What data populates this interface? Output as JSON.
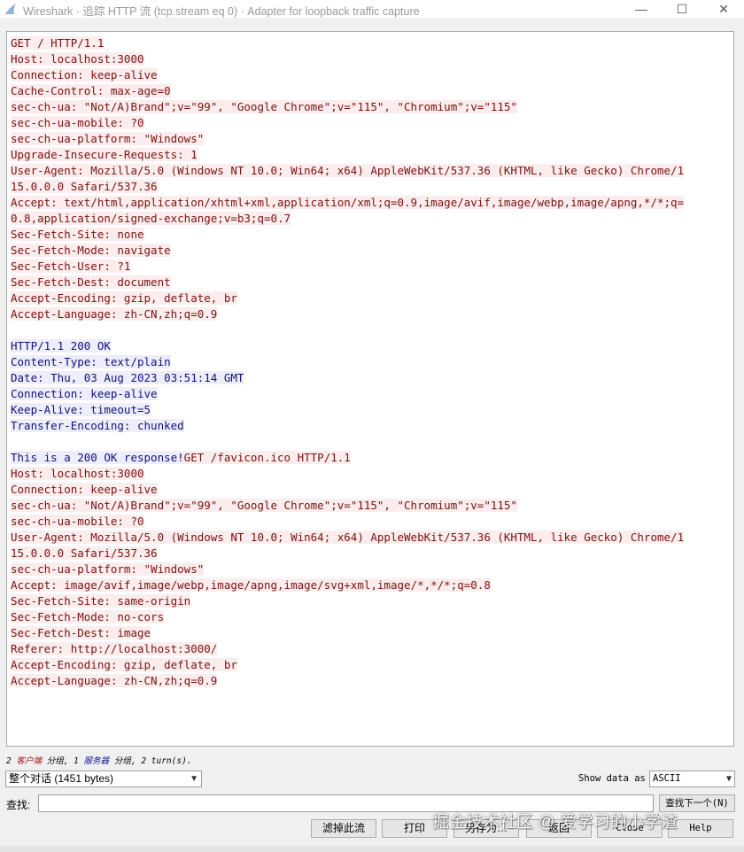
{
  "window": {
    "title": "Wireshark · 追踪 HTTP 流 (tcp.stream eq 0) · Adapter for loopback traffic capture",
    "icon": "wireshark-fin-icon",
    "controls": {
      "minimize": "—",
      "maximize": "☐",
      "close": "✕"
    }
  },
  "stream": {
    "lines": [
      [
        {
          "text": "GET / HTTP/1.1",
          "from": "client"
        }
      ],
      [
        {
          "text": "Host: localhost:3000",
          "from": "client"
        }
      ],
      [
        {
          "text": "Connection: keep-alive",
          "from": "client"
        }
      ],
      [
        {
          "text": "Cache-Control: max-age=0",
          "from": "client"
        }
      ],
      [
        {
          "text": "sec-ch-ua: \"Not/A)Brand\";v=\"99\", \"Google Chrome\";v=\"115\", \"Chromium\";v=\"115\"",
          "from": "client"
        }
      ],
      [
        {
          "text": "sec-ch-ua-mobile: ?0",
          "from": "client"
        }
      ],
      [
        {
          "text": "sec-ch-ua-platform: \"Windows\"",
          "from": "client"
        }
      ],
      [
        {
          "text": "Upgrade-Insecure-Requests: 1",
          "from": "client"
        }
      ],
      [
        {
          "text": "User-Agent: Mozilla/5.0 (Windows NT 10.0; Win64; x64) AppleWebKit/537.36 (KHTML, like Gecko) Chrome/1",
          "from": "client"
        }
      ],
      [
        {
          "text": "15.0.0.0 Safari/537.36",
          "from": "client"
        }
      ],
      [
        {
          "text": "Accept: text/html,application/xhtml+xml,application/xml;q=0.9,image/avif,image/webp,image/apng,*/*;q=",
          "from": "client"
        }
      ],
      [
        {
          "text": "0.8,application/signed-exchange;v=b3;q=0.7",
          "from": "client"
        }
      ],
      [
        {
          "text": "Sec-Fetch-Site: none",
          "from": "client"
        }
      ],
      [
        {
          "text": "Sec-Fetch-Mode: navigate",
          "from": "client"
        }
      ],
      [
        {
          "text": "Sec-Fetch-User: ?1",
          "from": "client"
        }
      ],
      [
        {
          "text": "Sec-Fetch-Dest: document",
          "from": "client"
        }
      ],
      [
        {
          "text": "Accept-Encoding: gzip, deflate, br",
          "from": "client"
        }
      ],
      [
        {
          "text": "Accept-Language: zh-CN,zh;q=0.9",
          "from": "client"
        }
      ],
      [],
      [
        {
          "text": "HTTP/1.1 200 OK",
          "from": "server"
        }
      ],
      [
        {
          "text": "Content-Type: text/plain",
          "from": "server"
        }
      ],
      [
        {
          "text": "Date: Thu, 03 Aug 2023 03:51:14 GMT",
          "from": "server"
        }
      ],
      [
        {
          "text": "Connection: keep-alive",
          "from": "server"
        }
      ],
      [
        {
          "text": "Keep-Alive: timeout=5",
          "from": "server"
        }
      ],
      [
        {
          "text": "Transfer-Encoding: chunked",
          "from": "server"
        }
      ],
      [],
      [
        {
          "text": "This is a 200 OK response!",
          "from": "server"
        },
        {
          "text": "GET /favicon.ico HTTP/1.1",
          "from": "client"
        }
      ],
      [
        {
          "text": "Host: localhost:3000",
          "from": "client"
        }
      ],
      [
        {
          "text": "Connection: keep-alive",
          "from": "client"
        }
      ],
      [
        {
          "text": "sec-ch-ua: \"Not/A)Brand\";v=\"99\", \"Google Chrome\";v=\"115\", \"Chromium\";v=\"115\"",
          "from": "client"
        }
      ],
      [
        {
          "text": "sec-ch-ua-mobile: ?0",
          "from": "client"
        }
      ],
      [
        {
          "text": "User-Agent: Mozilla/5.0 (Windows NT 10.0; Win64; x64) AppleWebKit/537.36 (KHTML, like Gecko) Chrome/1",
          "from": "client"
        }
      ],
      [
        {
          "text": "15.0.0.0 Safari/537.36",
          "from": "client"
        }
      ],
      [
        {
          "text": "sec-ch-ua-platform: \"Windows\"",
          "from": "client"
        }
      ],
      [
        {
          "text": "Accept: image/avif,image/webp,image/apng,image/svg+xml,image/*,*/*;q=0.8",
          "from": "client"
        }
      ],
      [
        {
          "text": "Sec-Fetch-Site: same-origin",
          "from": "client"
        }
      ],
      [
        {
          "text": "Sec-Fetch-Mode: no-cors",
          "from": "client"
        }
      ],
      [
        {
          "text": "Sec-Fetch-Dest: image",
          "from": "client"
        }
      ],
      [
        {
          "text": "Referer: http://localhost:3000/",
          "from": "client"
        }
      ],
      [
        {
          "text": "Accept-Encoding: gzip, deflate, br",
          "from": "client"
        }
      ],
      [
        {
          "text": "Accept-Language: zh-CN,zh;q=0.9",
          "from": "client"
        }
      ]
    ]
  },
  "status": {
    "client_count": "2",
    "client_label": "客户端",
    "sep1": " 分组, ",
    "server_count": "1",
    "server_label": "服务器",
    "sep2": " 分组, ",
    "turns": "2 turn(s)."
  },
  "controls": {
    "conversation_select": "整个对话 (1451 bytes)",
    "show_data_label": "Show data as",
    "encoding_select": "ASCII",
    "find_label": "查找:",
    "find_value": "",
    "find_next": "查找下一个(N)"
  },
  "buttons": {
    "filter_out": "滤掉此流",
    "print": "打印",
    "save_as": "另存为…",
    "back": "返回",
    "close": "Close",
    "help": "Help"
  },
  "watermark": "掘金技术社区 @ 爱学习的小学渣",
  "colors": {
    "client_bg": "#fbeded",
    "client_fg": "#7a1212",
    "server_bg": "#ededfb",
    "server_fg": "#12127a"
  }
}
